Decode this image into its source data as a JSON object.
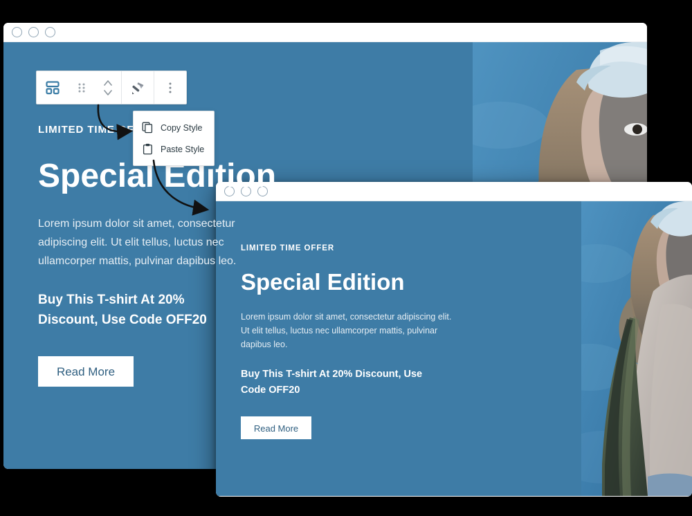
{
  "colors": {
    "hero_background": "#3e7ca6",
    "toolbar_accent": "#3a7ca5",
    "button_text": "#2f5f80",
    "page_background": "#000000",
    "eyebrow_text": "#ffffff",
    "body_text": "#e6eef4"
  },
  "window_back": {
    "name": "Editor preview window (behind)",
    "titlebar": {
      "dots": [
        "window-dot-1",
        "window-dot-2",
        "window-dot-3"
      ]
    },
    "hero": {
      "eyebrow": "LIMITED TIME OFFER",
      "headline": "Special Edition",
      "body": "Lorem ipsum dolor sit amet, consectetur adipiscing elit. Ut elit tellus, luctus nec ullamcorper mattis, pulvinar dapibus leo.",
      "promo": "Buy This T-shirt At 20% Discount, Use Code OFF20",
      "cta_label": "Read More",
      "photo_alt": "woman-in-bucket-hat-photo"
    }
  },
  "window_front": {
    "name": "Editor preview window (front)",
    "titlebar": {
      "dots": [
        "window-dot-1",
        "window-dot-2",
        "window-dot-3"
      ]
    },
    "hero": {
      "eyebrow": "LIMITED TIME OFFER",
      "headline": "Special Edition",
      "body": "Lorem ipsum dolor sit amet, consectetur adipiscing elit. Ut elit tellus, luctus nec ullamcorper mattis, pulvinar dapibus leo.",
      "promo": "Buy This T-shirt At 20% Discount, Use Code OFF20",
      "cta_label": "Read More",
      "photo_alt": "woman-in-bucket-hat-photo"
    }
  },
  "block_toolbar": {
    "buttons": [
      {
        "name": "block-type-columns-icon",
        "title": "Columns block",
        "icon": "columns-block-icon"
      },
      {
        "name": "drag-handle-icon",
        "title": "Drag",
        "icon": "drag-dots-icon"
      },
      {
        "name": "move-up-down-icon",
        "title": "Move up or down",
        "icon": "chevron-up-down-icon"
      },
      {
        "name": "copy-paste-style-icon",
        "title": "Copy / paste style",
        "icon": "paintbrush-icon"
      },
      {
        "name": "more-options-icon",
        "title": "Options",
        "icon": "kebab-menu-icon"
      }
    ]
  },
  "style_popup": {
    "items": [
      {
        "label": "Copy Style",
        "icon": "copy-icon"
      },
      {
        "label": "Paste Style",
        "icon": "clipboard-icon"
      }
    ]
  }
}
